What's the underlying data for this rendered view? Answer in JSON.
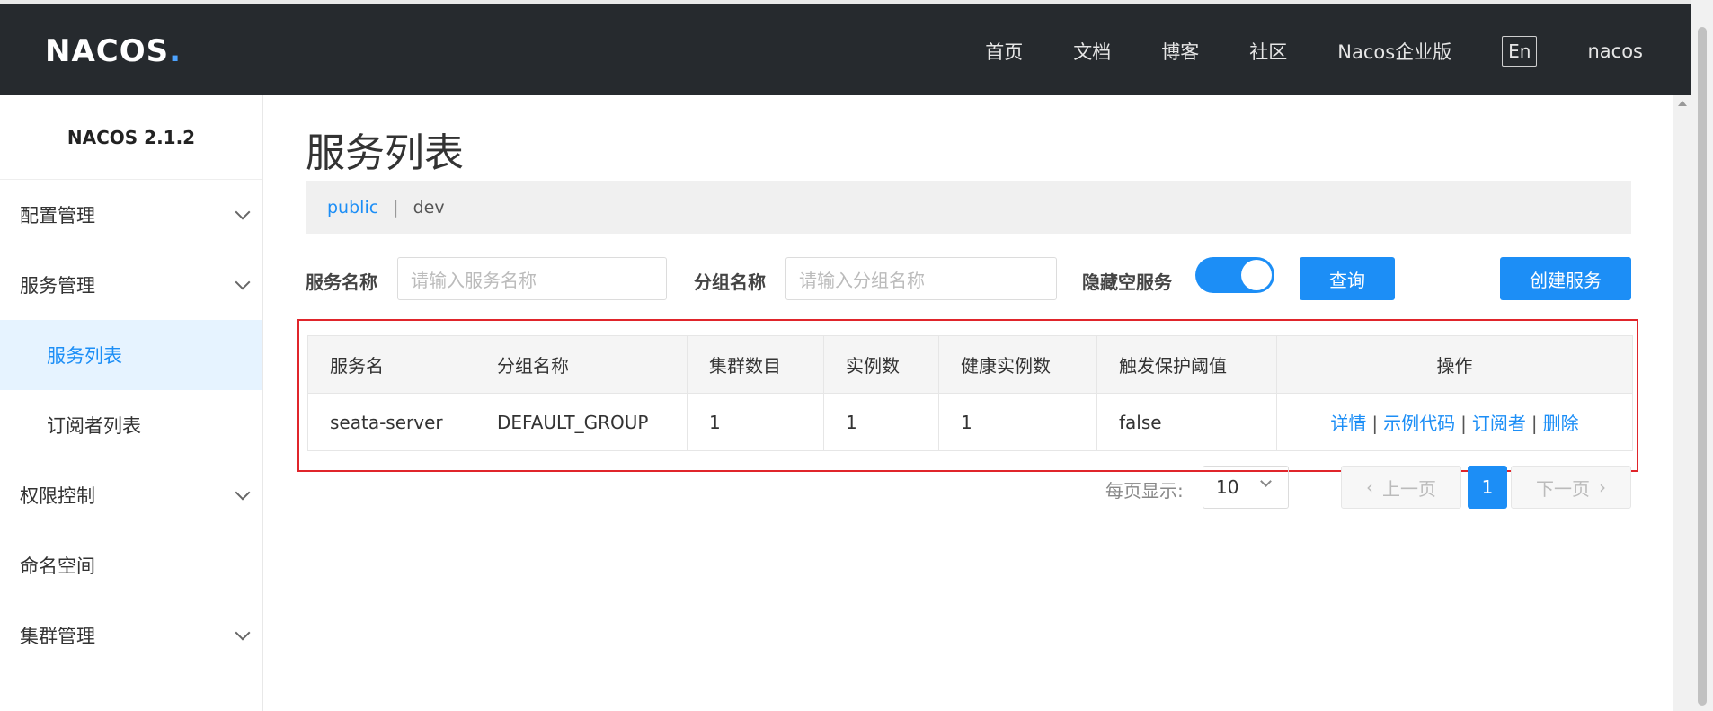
{
  "header": {
    "logo_text": "NACOS",
    "logo_dot": ".",
    "nav": [
      "首页",
      "文档",
      "博客",
      "社区",
      "Nacos企业版"
    ],
    "lang": "En",
    "user": "nacos"
  },
  "sidebar": {
    "version": "NACOS 2.1.2",
    "items": [
      {
        "label": "配置管理"
      },
      {
        "label": "服务管理"
      },
      {
        "label": "服务列表"
      },
      {
        "label": "订阅者列表"
      },
      {
        "label": "权限控制"
      },
      {
        "label": "命名空间"
      },
      {
        "label": "集群管理"
      }
    ]
  },
  "main": {
    "title": "服务列表",
    "namespaces": {
      "active": "public",
      "separator": "|",
      "other": "dev"
    },
    "filters": {
      "service_label": "服务名称",
      "service_placeholder": "请输入服务名称",
      "group_label": "分组名称",
      "group_placeholder": "请输入分组名称",
      "hide_empty_label": "隐藏空服务",
      "query_button": "查询",
      "create_button": "创建服务"
    },
    "table": {
      "headers": [
        "服务名",
        "分组名称",
        "集群数目",
        "实例数",
        "健康实例数",
        "触发保护阈值",
        "操作"
      ],
      "rows": [
        {
          "service": "seata-server",
          "group": "DEFAULT_GROUP",
          "clusters": "1",
          "instances": "1",
          "healthy": "1",
          "threshold": "false"
        }
      ],
      "actions": [
        "详情",
        "示例代码",
        "订阅者",
        "删除"
      ],
      "action_sep": "|"
    },
    "pager": {
      "label": "每页显示:",
      "page_size": "10",
      "prev": "上一页",
      "next": "下一页",
      "current": "1"
    }
  },
  "colors": {
    "accent": "#1c8ef6",
    "header_bg": "#262a2e",
    "highlight_border": "#e0252b"
  }
}
